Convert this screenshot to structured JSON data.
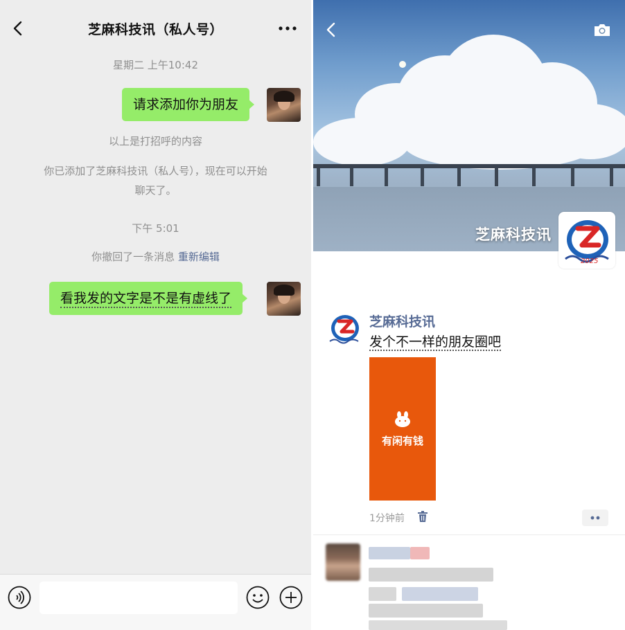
{
  "chat": {
    "title": "芝麻科技讯（私人号）",
    "timestamp_1": "星期二 上午10:42",
    "message_1": "请求添加你为朋友",
    "system_greeting": "以上是打招呼的内容",
    "system_added_line1": "你已添加了芝麻科技讯（私人号），现在可以开始",
    "system_added_line2": "聊天了。",
    "timestamp_2": "下午 5:01",
    "recalled_text": "你撤回了一条消息",
    "reedit_link": "重新编辑",
    "message_2": "看我发的文字是不是有虚线了",
    "colors": {
      "bubble": "#95ec69",
      "background": "#ededed",
      "link": "#576b95"
    }
  },
  "moments": {
    "cover_name": "芝麻科技讯",
    "post": {
      "author": "芝麻科技讯",
      "text": "发个不一样的朋友圈吧",
      "image_label": "有闲有钱",
      "time": "1分钟前"
    },
    "colors": {
      "image_bg": "#e8580c",
      "author": "#576b95"
    }
  },
  "icons": [
    "back-icon",
    "more-icon",
    "voice-icon",
    "emoji-icon",
    "plus-icon",
    "camera-icon",
    "delete-icon",
    "more-dots-icon"
  ]
}
